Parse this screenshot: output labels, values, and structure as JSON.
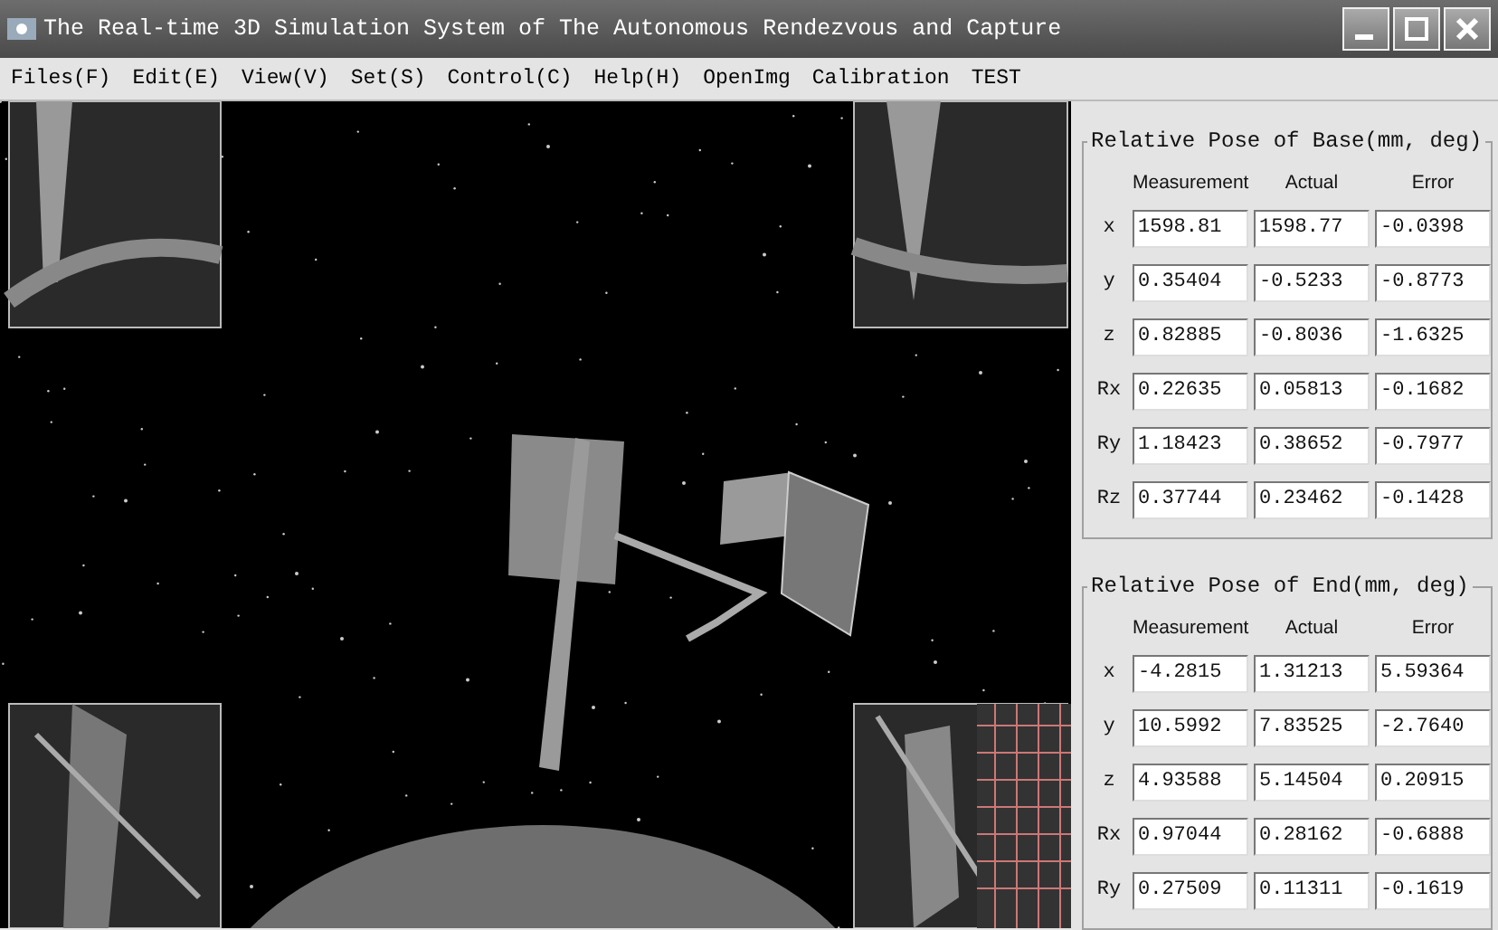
{
  "window": {
    "title": "The Real-time 3D Simulation System of The Autonomous Rendezvous and Capture"
  },
  "menu": [
    "Files(F)",
    "Edit(E)",
    "View(V)",
    "Set(S)",
    "Control(C)",
    "Help(H)",
    "OpenImg",
    "Calibration",
    "TEST"
  ],
  "pose_groups": [
    {
      "title": "Relative Pose of Base(mm, deg)",
      "columns": [
        "Measurement",
        "Actual",
        "Error"
      ],
      "rows": [
        {
          "label": "x",
          "values": [
            "1598.81",
            "1598.77",
            "-0.0398"
          ]
        },
        {
          "label": "y",
          "values": [
            "0.35404",
            "-0.5233",
            "-0.8773"
          ]
        },
        {
          "label": "z",
          "values": [
            "0.82885",
            "-0.8036",
            "-1.6325"
          ]
        },
        {
          "label": "Rx",
          "values": [
            "0.22635",
            "0.05813",
            "-0.1682"
          ]
        },
        {
          "label": "Ry",
          "values": [
            "1.18423",
            "0.38652",
            "-0.7977"
          ]
        },
        {
          "label": "Rz",
          "values": [
            "0.37744",
            "0.23462",
            "-0.1428"
          ]
        }
      ]
    },
    {
      "title": "Relative Pose of End(mm, deg)",
      "columns": [
        "Measurement",
        "Actual",
        "Error"
      ],
      "rows": [
        {
          "label": "x",
          "values": [
            "-4.2815",
            "1.31213",
            "5.59364"
          ]
        },
        {
          "label": "y",
          "values": [
            "10.5992",
            "7.83525",
            "-2.7640"
          ]
        },
        {
          "label": "z",
          "values": [
            "4.93588",
            "5.14504",
            "0.20915"
          ]
        },
        {
          "label": "Rx",
          "values": [
            "0.97044",
            "0.28162",
            "-0.6888"
          ]
        },
        {
          "label": "Ry",
          "values": [
            "0.27509",
            "0.11311",
            "-0.1619"
          ]
        }
      ]
    }
  ]
}
